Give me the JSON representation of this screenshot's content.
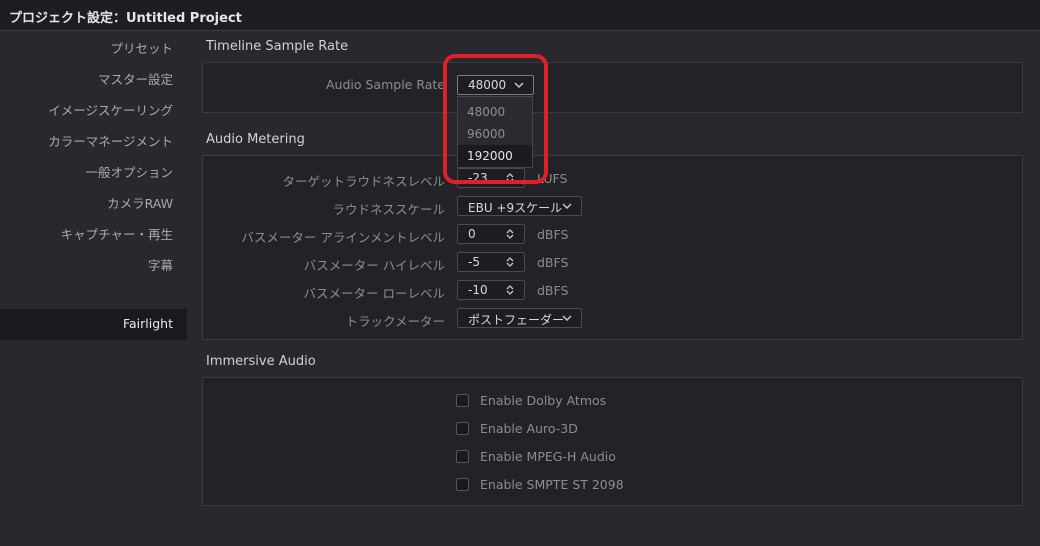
{
  "window": {
    "title": "プロジェクト設定：Untitled Project"
  },
  "sidebar": {
    "items": [
      {
        "label": "プリセット"
      },
      {
        "label": "マスター設定"
      },
      {
        "label": "イメージスケーリング"
      },
      {
        "label": "カラーマネージメント"
      },
      {
        "label": "一般オプション"
      },
      {
        "label": "カメラRAW"
      },
      {
        "label": "キャプチャー・再生"
      },
      {
        "label": "字幕"
      },
      {
        "label": "Fairlight"
      }
    ],
    "active": "Fairlight"
  },
  "timeline_sample_rate": {
    "title": "Timeline Sample Rate",
    "label": "Audio Sample Rate",
    "value": "48000",
    "options": [
      "48000",
      "96000",
      "192000"
    ],
    "highlighted_option": "192000"
  },
  "audio_metering": {
    "title": "Audio Metering",
    "target_loudness": {
      "label": "ターゲットラウドネスレベル",
      "value": "-23",
      "unit": "LUFS"
    },
    "loudness_scale": {
      "label": "ラウドネススケール",
      "value": "EBU +9スケール"
    },
    "bus_meter_alignment": {
      "label": "バスメーター アラインメントレベル",
      "value": "0",
      "unit": "dBFS"
    },
    "bus_meter_high": {
      "label": "バスメーター ハイレベル",
      "value": "-5",
      "unit": "dBFS"
    },
    "bus_meter_low": {
      "label": "バスメーター ローレベル",
      "value": "-10",
      "unit": "dBFS"
    },
    "track_meter": {
      "label": "トラックメーター",
      "value": "ポストフェーダー"
    }
  },
  "immersive_audio": {
    "title": "Immersive Audio",
    "options": [
      {
        "label": "Enable Dolby Atmos",
        "checked": false
      },
      {
        "label": "Enable Auro-3D",
        "checked": false
      },
      {
        "label": "Enable MPEG-H Audio",
        "checked": false
      },
      {
        "label": "Enable SMPTE ST 2098",
        "checked": false
      }
    ]
  },
  "colors": {
    "annotation": "#e02028",
    "background": "#28282e",
    "panel": "#222227"
  }
}
